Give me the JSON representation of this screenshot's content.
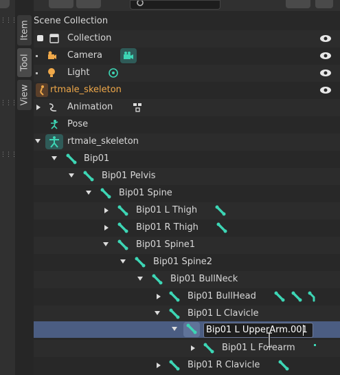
{
  "tabs": [
    {
      "label": "Item"
    },
    {
      "label": "Tool"
    },
    {
      "label": "View"
    }
  ],
  "tree": {
    "rows": [
      {
        "label": "Scene Collection"
      },
      {
        "label": "Collection"
      },
      {
        "label": "Camera"
      },
      {
        "label": "Light"
      },
      {
        "label": "rtmale_skeleton"
      },
      {
        "label": "Animation"
      },
      {
        "label": "Pose"
      },
      {
        "label": "rtmale_skeleton"
      },
      {
        "label": "Bip01"
      },
      {
        "label": "Bip01 Pelvis"
      },
      {
        "label": "Bip01 Spine"
      },
      {
        "label": "Bip01 L Thigh"
      },
      {
        "label": "Bip01 R Thigh"
      },
      {
        "label": "Bip01 Spine1"
      },
      {
        "label": "Bip01 Spine2"
      },
      {
        "label": "Bip01 BullNeck"
      },
      {
        "label": "Bip01 BullHead"
      },
      {
        "label": "Bip01 L Clavicle"
      },
      {
        "label": "Bip01 L UpperArm.001"
      },
      {
        "label": "Bip01 L Forearm"
      },
      {
        "label": "Bip01 R Clavicle"
      }
    ]
  },
  "colors": {
    "bone": "#3dd6b5",
    "selected_row": "#4b5d82",
    "armature_label": "#f0a94a"
  }
}
